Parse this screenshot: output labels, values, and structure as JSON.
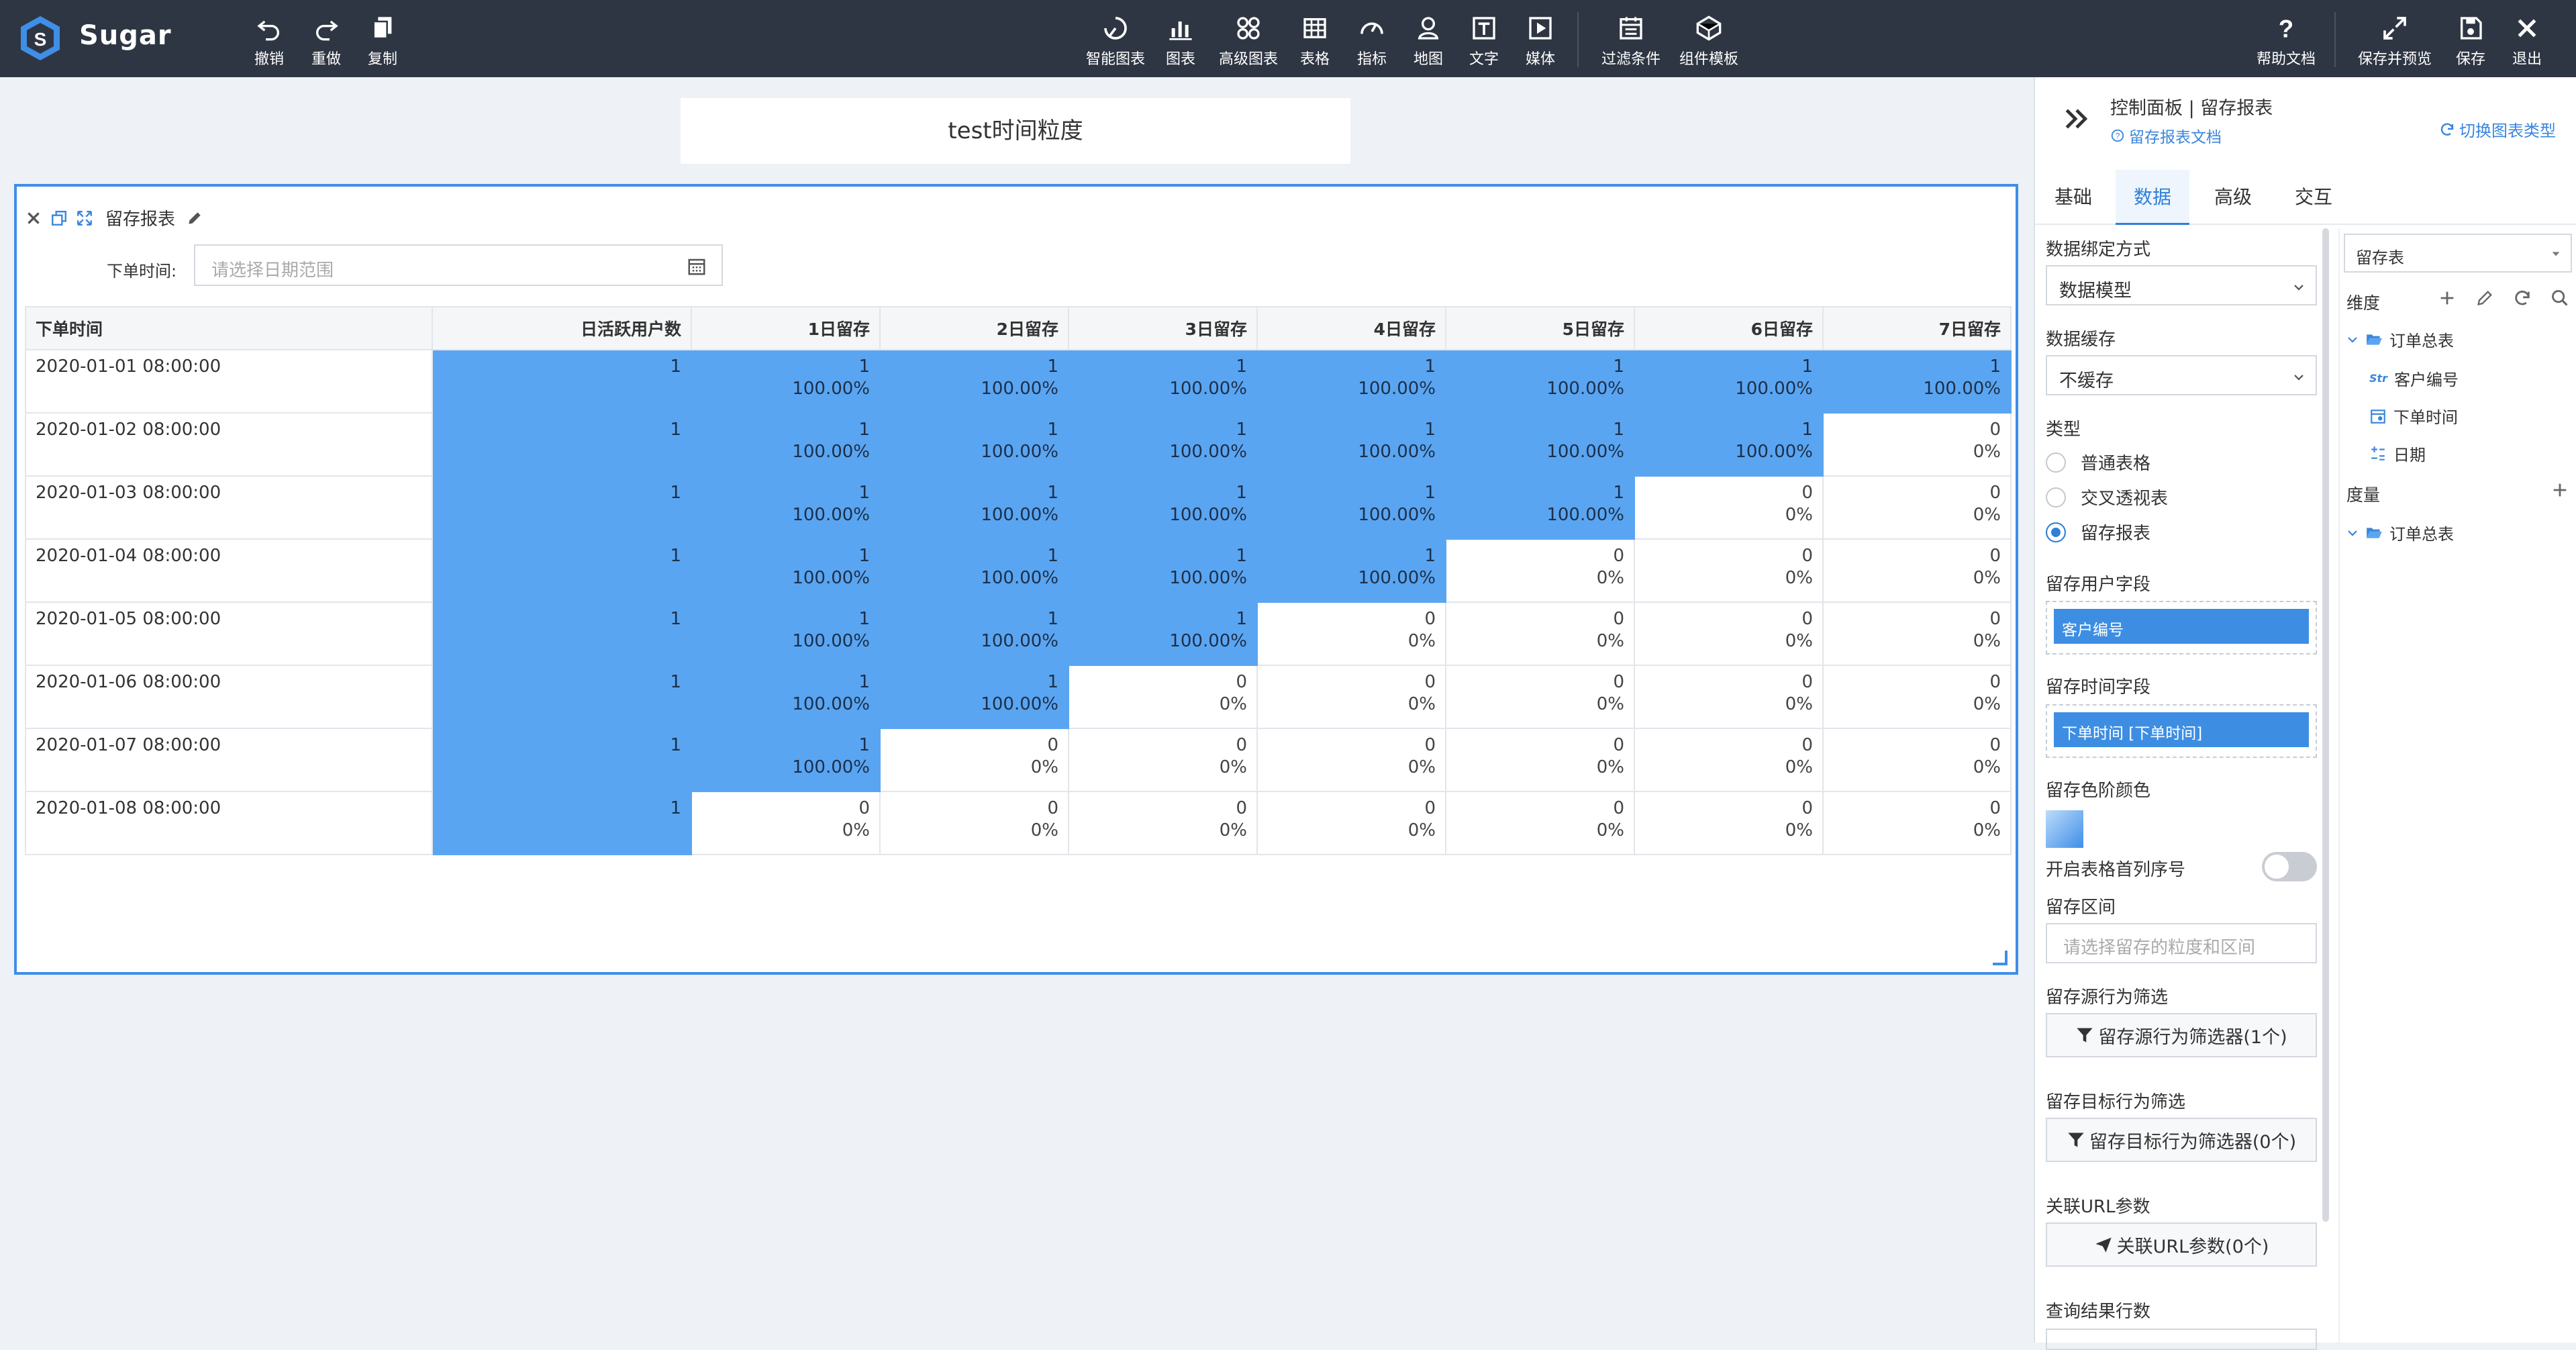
{
  "app": {
    "brand": "Sugar"
  },
  "toolbar": {
    "left": [
      {
        "label": "撤销",
        "icon": "undo-icon"
      },
      {
        "label": "重做",
        "icon": "redo-icon"
      },
      {
        "label": "复制",
        "icon": "copy-icon"
      }
    ],
    "center": [
      {
        "label": "智能图表",
        "icon": "smart-chart-icon"
      },
      {
        "label": "图表",
        "icon": "bar-chart-icon"
      },
      {
        "label": "高级图表",
        "icon": "advanced-chart-icon"
      },
      {
        "label": "表格",
        "icon": "table-icon"
      },
      {
        "label": "指标",
        "icon": "gauge-icon"
      },
      {
        "label": "地图",
        "icon": "map-pin-icon"
      },
      {
        "label": "文字",
        "icon": "text-icon"
      },
      {
        "label": "媒体",
        "icon": "media-icon"
      },
      {
        "label": "过滤条件",
        "icon": "filter-calendar-icon"
      },
      {
        "label": "组件模板",
        "icon": "template-icon"
      }
    ],
    "right": [
      {
        "label": "帮助文档",
        "icon": "help-icon"
      },
      {
        "label": "保存并预览",
        "icon": "expand-icon"
      },
      {
        "label": "保存",
        "icon": "save-icon"
      },
      {
        "label": "退出",
        "icon": "close-icon"
      }
    ]
  },
  "canvas": {
    "title": "test时间粒度",
    "widget": {
      "title": "留存报表",
      "filter_label": "下单时间:",
      "filter_placeholder": "请选择日期范围",
      "columns": [
        "下单时间",
        "日活跃用户数",
        "1日留存",
        "2日留存",
        "3日留存",
        "4日留存",
        "5日留存",
        "6日留存",
        "7日留存"
      ],
      "rows": [
        {
          "date": "2020-01-01 08:00:00",
          "dau": "1",
          "cells": [
            [
              "1",
              "100.00%"
            ],
            [
              "1",
              "100.00%"
            ],
            [
              "1",
              "100.00%"
            ],
            [
              "1",
              "100.00%"
            ],
            [
              "1",
              "100.00%"
            ],
            [
              "1",
              "100.00%"
            ],
            [
              "1",
              "100.00%"
            ]
          ]
        },
        {
          "date": "2020-01-02 08:00:00",
          "dau": "1",
          "cells": [
            [
              "1",
              "100.00%"
            ],
            [
              "1",
              "100.00%"
            ],
            [
              "1",
              "100.00%"
            ],
            [
              "1",
              "100.00%"
            ],
            [
              "1",
              "100.00%"
            ],
            [
              "1",
              "100.00%"
            ],
            [
              "0",
              "0%"
            ]
          ]
        },
        {
          "date": "2020-01-03 08:00:00",
          "dau": "1",
          "cells": [
            [
              "1",
              "100.00%"
            ],
            [
              "1",
              "100.00%"
            ],
            [
              "1",
              "100.00%"
            ],
            [
              "1",
              "100.00%"
            ],
            [
              "1",
              "100.00%"
            ],
            [
              "0",
              "0%"
            ],
            [
              "0",
              "0%"
            ]
          ]
        },
        {
          "date": "2020-01-04 08:00:00",
          "dau": "1",
          "cells": [
            [
              "1",
              "100.00%"
            ],
            [
              "1",
              "100.00%"
            ],
            [
              "1",
              "100.00%"
            ],
            [
              "1",
              "100.00%"
            ],
            [
              "0",
              "0%"
            ],
            [
              "0",
              "0%"
            ],
            [
              "0",
              "0%"
            ]
          ]
        },
        {
          "date": "2020-01-05 08:00:00",
          "dau": "1",
          "cells": [
            [
              "1",
              "100.00%"
            ],
            [
              "1",
              "100.00%"
            ],
            [
              "1",
              "100.00%"
            ],
            [
              "0",
              "0%"
            ],
            [
              "0",
              "0%"
            ],
            [
              "0",
              "0%"
            ],
            [
              "0",
              "0%"
            ]
          ]
        },
        {
          "date": "2020-01-06 08:00:00",
          "dau": "1",
          "cells": [
            [
              "1",
              "100.00%"
            ],
            [
              "1",
              "100.00%"
            ],
            [
              "0",
              "0%"
            ],
            [
              "0",
              "0%"
            ],
            [
              "0",
              "0%"
            ],
            [
              "0",
              "0%"
            ],
            [
              "0",
              "0%"
            ]
          ]
        },
        {
          "date": "2020-01-07 08:00:00",
          "dau": "1",
          "cells": [
            [
              "1",
              "100.00%"
            ],
            [
              "0",
              "0%"
            ],
            [
              "0",
              "0%"
            ],
            [
              "0",
              "0%"
            ],
            [
              "0",
              "0%"
            ],
            [
              "0",
              "0%"
            ],
            [
              "0",
              "0%"
            ]
          ]
        },
        {
          "date": "2020-01-08 08:00:00",
          "dau": "1",
          "cells": [
            [
              "0",
              "0%"
            ],
            [
              "0",
              "0%"
            ],
            [
              "0",
              "0%"
            ],
            [
              "0",
              "0%"
            ],
            [
              "0",
              "0%"
            ],
            [
              "0",
              "0%"
            ],
            [
              "0",
              "0%"
            ]
          ]
        }
      ],
      "highlight_color": "#5aa5f1"
    }
  },
  "panel": {
    "breadcrumb": "控制面板 | 留存报表",
    "doc_link": "留存报表文档",
    "switch_link": "切换图表类型",
    "tabs": [
      "基础",
      "数据",
      "高级",
      "交互"
    ],
    "active_tab": "数据",
    "binding_label": "数据绑定方式",
    "binding_value": "数据模型",
    "cache_label": "数据缓存",
    "cache_value": "不缓存",
    "type_label": "类型",
    "type_options": [
      "普通表格",
      "交叉透视表",
      "留存报表"
    ],
    "type_selected": "留存报表",
    "user_field_label": "留存用户字段",
    "user_field_value": "客户编号",
    "time_field_label": "留存时间字段",
    "time_field_value": "下单时间 [下单时间]",
    "color_label": "留存色阶颜色",
    "serial_label": "开启表格首列序号",
    "range_label": "留存区间",
    "range_placeholder": "请选择留存的粒度和区间",
    "source_filter_label": "留存源行为筛选",
    "source_filter_btn": "留存源行为筛选器(1个)",
    "target_filter_label": "留存目标行为筛选",
    "target_filter_btn": "留存目标行为筛选器(0个)",
    "url_label": "关联URL参数",
    "url_btn": "关联URL参数(0个)",
    "rows_label": "查询结果行数",
    "accent": "#2f7fd8"
  },
  "fields": {
    "table_select": "留存表",
    "dimension_label": "维度",
    "measure_label": "度量",
    "dim_folder": "订单总表",
    "dim_items": [
      {
        "tag": "Str",
        "name": "客户编号"
      },
      {
        "tag": "date",
        "name": "下单时间"
      },
      {
        "tag": "calc",
        "name": "日期"
      }
    ],
    "measure_folder": "订单总表"
  }
}
